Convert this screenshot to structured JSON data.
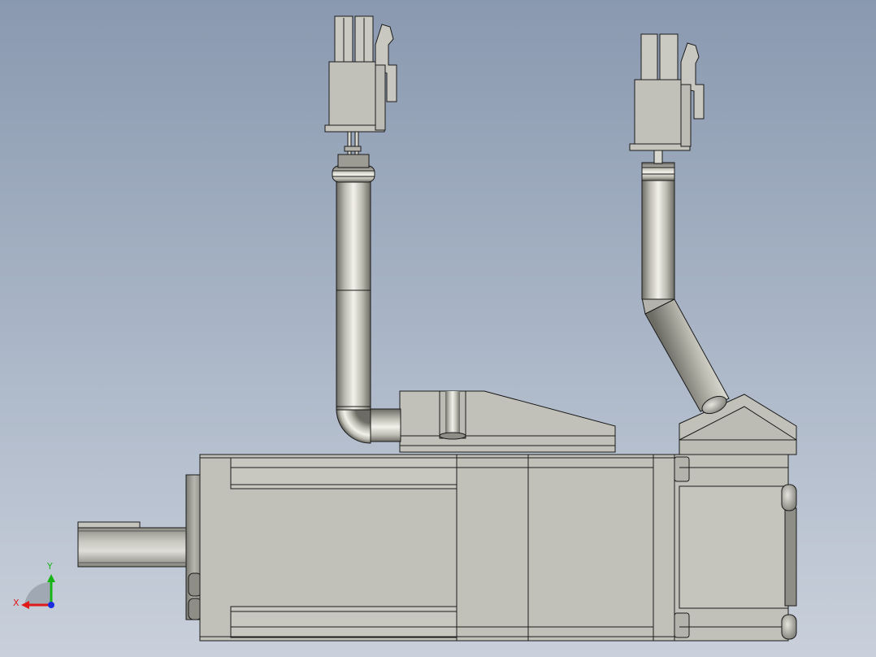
{
  "viewport": {
    "background_top": "#8a99b0",
    "background_bottom": "#c9d0db"
  },
  "model": {
    "body_color": "#c2c1b9",
    "edge_color": "#1a1a1a",
    "cable_color": "#bdbcb2",
    "cable_highlight": "#f2f1ea",
    "cable_shadow": "#6c6b64"
  },
  "triad": {
    "x_label": "X",
    "y_label": "Y",
    "x_color": "#e01a1a",
    "y_color": "#17b417",
    "z_color": "#1a2ee0"
  }
}
